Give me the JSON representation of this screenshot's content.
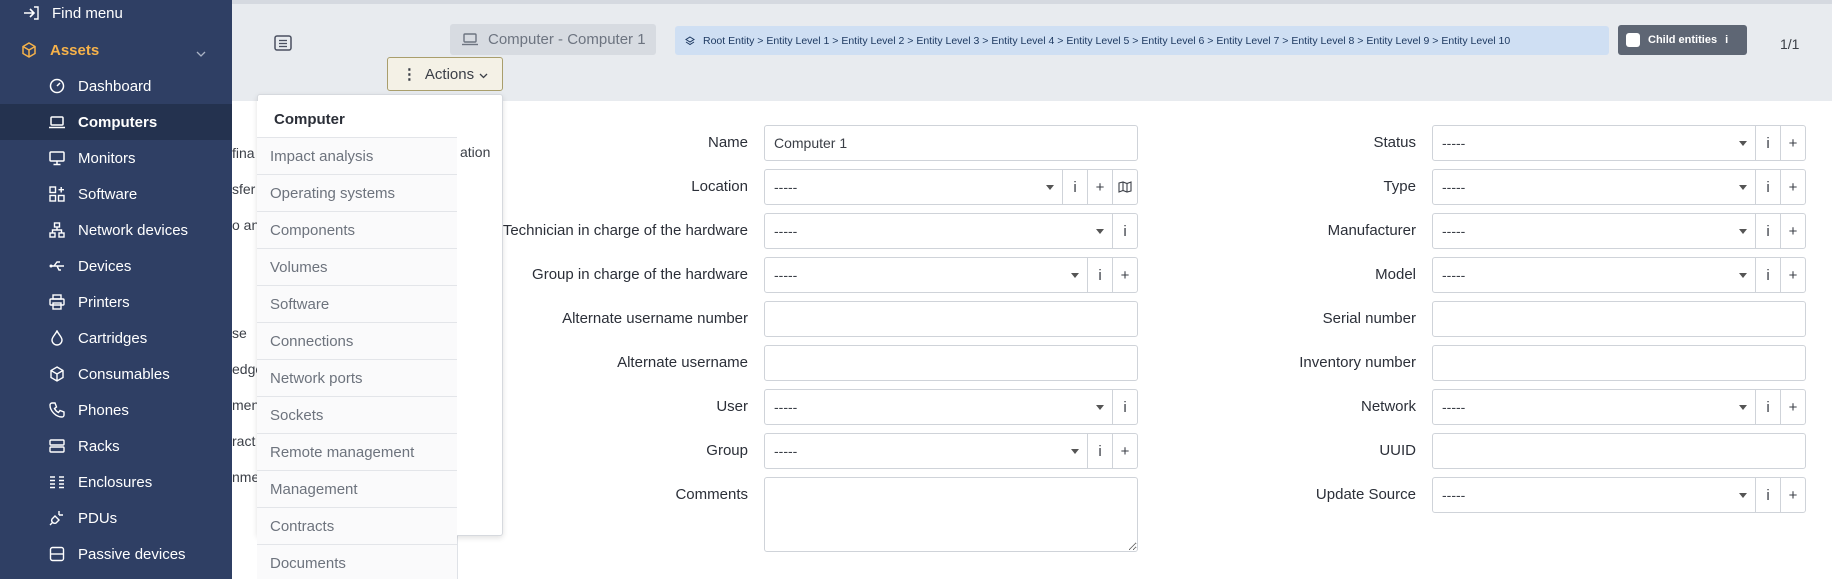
{
  "sidebar": {
    "find_menu": "Find menu",
    "group": "Assets",
    "items": [
      {
        "label": "Dashboard",
        "icon": "dashboard-icon"
      },
      {
        "label": "Computers",
        "icon": "laptop-icon",
        "active": true
      },
      {
        "label": "Monitors",
        "icon": "monitor-icon"
      },
      {
        "label": "Software",
        "icon": "apps-icon"
      },
      {
        "label": "Network devices",
        "icon": "network-icon"
      },
      {
        "label": "Devices",
        "icon": "usb-icon"
      },
      {
        "label": "Printers",
        "icon": "printer-icon"
      },
      {
        "label": "Cartridges",
        "icon": "droplet-icon"
      },
      {
        "label": "Consumables",
        "icon": "package-icon"
      },
      {
        "label": "Phones",
        "icon": "phone-icon"
      },
      {
        "label": "Racks",
        "icon": "server-icon"
      },
      {
        "label": "Enclosures",
        "icon": "columns-icon"
      },
      {
        "label": "PDUs",
        "icon": "plug-icon"
      },
      {
        "label": "Passive devices",
        "icon": "box-icon"
      }
    ]
  },
  "header": {
    "title": "Computer - Computer 1",
    "breadcrumb": "Root Entity > Entity Level 1 > Entity Level 2 > Entity Level 3 > Entity Level 4 > Entity Level 5 > Entity Level 6 > Entity Level 7 > Entity Level 8 > Entity Level 9 > Entity Level 10",
    "child_entities": "Child entities",
    "child_info": "i",
    "pager": "1/1",
    "actions": "Actions"
  },
  "menu": {
    "items": [
      "Computer",
      "Impact analysis",
      "Operating systems",
      "Components",
      "Volumes",
      "Software",
      "Connections",
      "Network ports",
      "Sockets",
      "Remote management",
      "Management",
      "Contracts",
      "Documents"
    ],
    "overflow_fragment": "ation"
  },
  "background_tabs": [
    "fina",
    "sfer",
    "o an",
    "se",
    "edge",
    "men",
    "ract",
    "nme"
  ],
  "form": {
    "left": [
      {
        "label": "Name",
        "value": "Computer 1",
        "kind": "text"
      },
      {
        "label": "Location",
        "value": "-----",
        "kind": "select",
        "buttons": [
          "i",
          "+",
          "map"
        ]
      },
      {
        "label": "Technician in charge of the hardware",
        "value": "-----",
        "kind": "select",
        "buttons": [
          "i"
        ]
      },
      {
        "label": "Group in charge of the hardware",
        "value": "-----",
        "kind": "select",
        "buttons": [
          "i",
          "+"
        ]
      },
      {
        "label": "Alternate username number",
        "value": "",
        "kind": "text"
      },
      {
        "label": "Alternate username",
        "value": "",
        "kind": "text"
      },
      {
        "label": "User",
        "value": "-----",
        "kind": "select",
        "buttons": [
          "i"
        ]
      },
      {
        "label": "Group",
        "value": "-----",
        "kind": "select",
        "buttons": [
          "i",
          "+"
        ]
      },
      {
        "label": "Comments",
        "value": "",
        "kind": "textarea"
      }
    ],
    "right": [
      {
        "label": "Status",
        "value": "-----",
        "kind": "select",
        "buttons": [
          "i",
          "+"
        ]
      },
      {
        "label": "Type",
        "value": "-----",
        "kind": "select",
        "buttons": [
          "i",
          "+"
        ]
      },
      {
        "label": "Manufacturer",
        "value": "-----",
        "kind": "select",
        "buttons": [
          "i",
          "+"
        ]
      },
      {
        "label": "Model",
        "value": "-----",
        "kind": "select",
        "buttons": [
          "i",
          "+"
        ]
      },
      {
        "label": "Serial number",
        "value": "",
        "kind": "text"
      },
      {
        "label": "Inventory number",
        "value": "",
        "kind": "text"
      },
      {
        "label": "Network",
        "value": "-----",
        "kind": "select",
        "buttons": [
          "i",
          "+"
        ]
      },
      {
        "label": "UUID",
        "value": "",
        "kind": "text"
      },
      {
        "label": "Update Source",
        "value": "-----",
        "kind": "select",
        "buttons": [
          "i",
          "+"
        ]
      }
    ]
  }
}
